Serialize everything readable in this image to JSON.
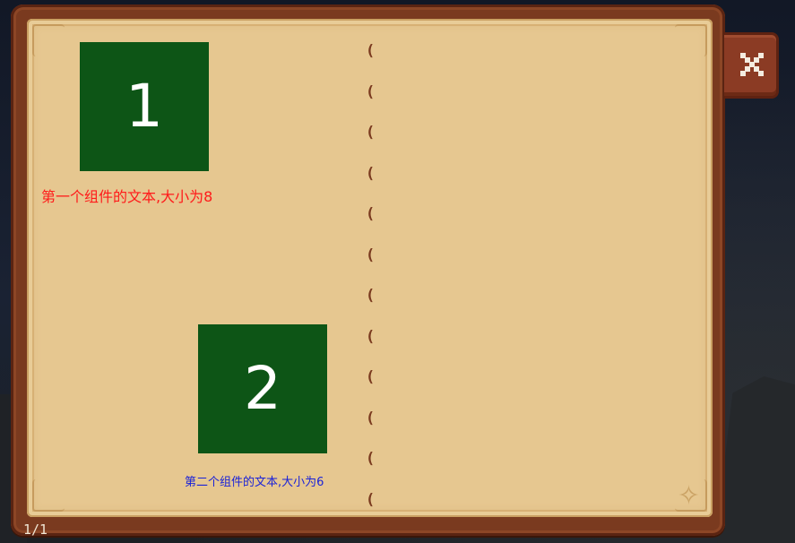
{
  "page_indicator": "1/1",
  "tiles": [
    {
      "number": "1",
      "caption": "第一个组件的文本,大小为8"
    },
    {
      "number": "2",
      "caption": "第二个组件的文本,大小为6"
    }
  ],
  "spine_mark": "(",
  "spine_count": 12,
  "close_button": {
    "icon": "close-icon"
  },
  "colors": {
    "tile": "#0d5516",
    "caption_1": "#ff1a1a",
    "caption_2": "#1a22d8",
    "page": "#e6c790",
    "frame": "#7a3a1f"
  }
}
